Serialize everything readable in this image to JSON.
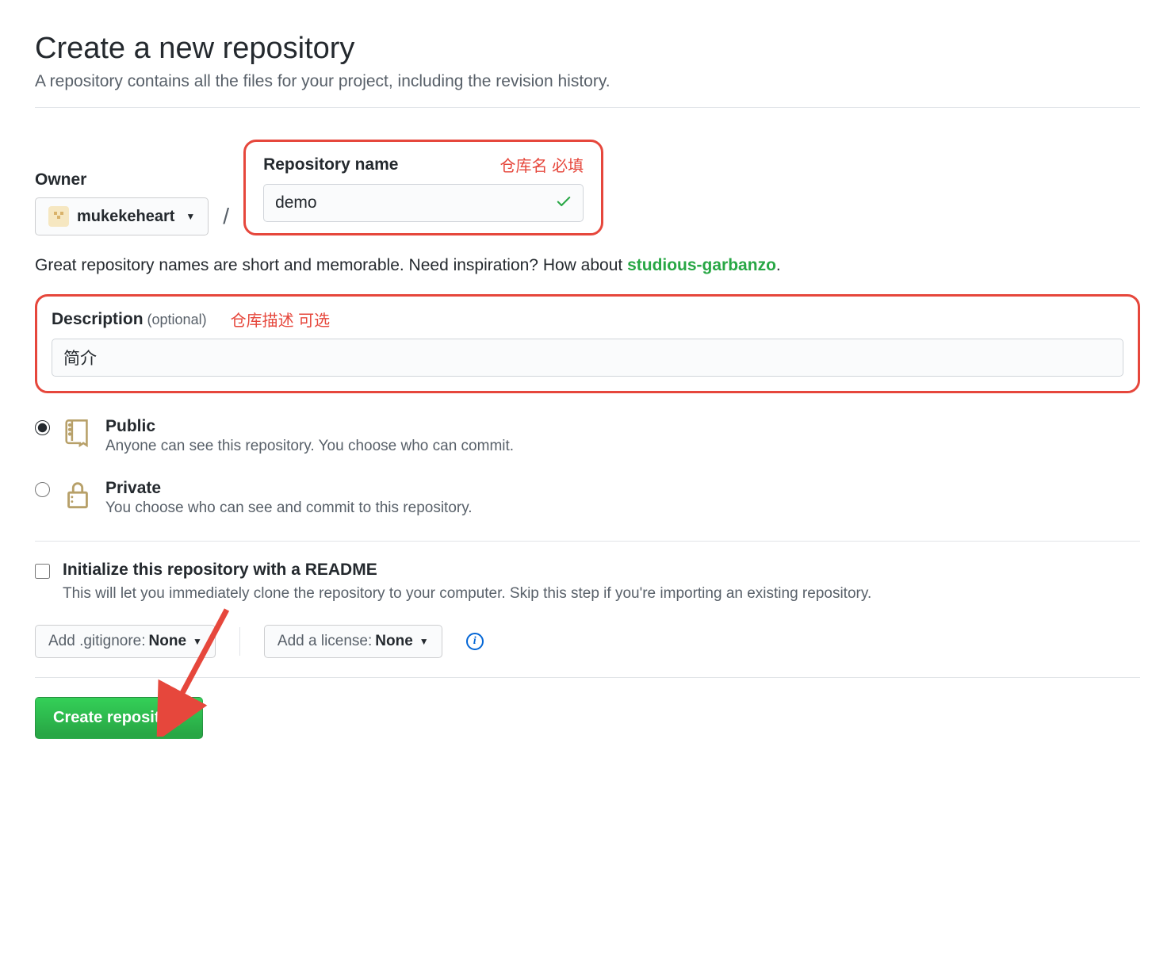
{
  "header": {
    "title": "Create a new repository",
    "subtitle": "A repository contains all the files for your project, including the revision history."
  },
  "owner": {
    "label": "Owner",
    "username": "mukekeheart"
  },
  "repo": {
    "label": "Repository name",
    "annotation": "仓库名 必填",
    "value": "demo"
  },
  "help": {
    "prefix": "Great repository names are short and memorable. Need inspiration? How about ",
    "suggestion": "studious-garbanzo",
    "suffix": "."
  },
  "description": {
    "label": "Description",
    "optional": " (optional)",
    "annotation": "仓库描述 可选",
    "value": "简介"
  },
  "visibility": {
    "public": {
      "title": "Public",
      "desc": "Anyone can see this repository. You choose who can commit."
    },
    "private": {
      "title": "Private",
      "desc": "You choose who can see and commit to this repository."
    }
  },
  "readme": {
    "title": "Initialize this repository with a README",
    "desc": "This will let you immediately clone the repository to your computer. Skip this step if you're importing an existing repository."
  },
  "dropdowns": {
    "gitignore_prefix": "Add .gitignore: ",
    "gitignore_value": "None",
    "license_prefix": "Add a license: ",
    "license_value": "None"
  },
  "submit": {
    "label": "Create repository"
  }
}
